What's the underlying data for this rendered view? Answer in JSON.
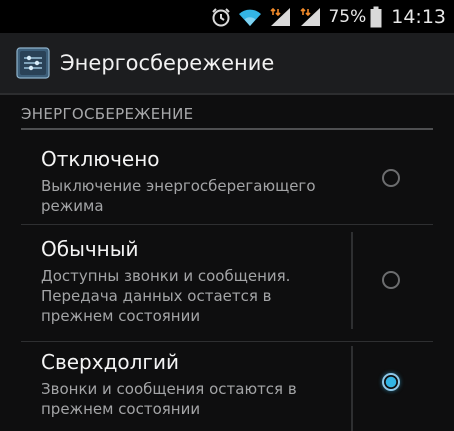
{
  "status_bar": {
    "icons": [
      "alarm-clock-icon",
      "wifi-icon",
      "signal-sim1-icon",
      "signal-sim2-icon",
      "battery-icon"
    ],
    "battery_percent": "75%",
    "time": "14:13",
    "colors": {
      "wifi": "#33b5e5",
      "signal_arrows": "#f08a2a"
    }
  },
  "action_bar": {
    "icon": "power-settings-icon",
    "title": "Энергосбережение"
  },
  "section": {
    "header": "ЭНЕРГОСБЕРЕЖЕНИЕ"
  },
  "options": [
    {
      "title": "Отключено",
      "summary": "Выключение энергосберегающего режима",
      "selected": false
    },
    {
      "title": "Обычный",
      "summary": "Доступны звонки и сообщения. Передача данных остается в прежнем состоянии",
      "selected": false
    },
    {
      "title": "Сверхдолгий",
      "summary": "Звонки и сообщения остаются в прежнем состоянии",
      "selected": true
    }
  ],
  "colors": {
    "background": "#0e0e0f",
    "accent": "#33b5e5",
    "header_text": "#a7a8aa"
  }
}
